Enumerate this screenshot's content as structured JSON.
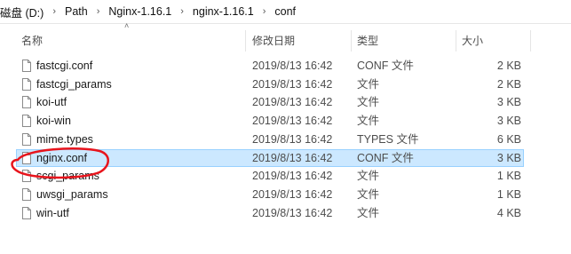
{
  "breadcrumb": [
    "磁盘 (D:)",
    "Path",
    "Nginx-1.16.1",
    "nginx-1.16.1",
    "conf"
  ],
  "columns": {
    "name": "名称",
    "date": "修改日期",
    "type": "类型",
    "size": "大小"
  },
  "files": [
    {
      "name": "fastcgi.conf",
      "date": "2019/8/13 16:42",
      "type": "CONF 文件",
      "size": "2 KB"
    },
    {
      "name": "fastcgi_params",
      "date": "2019/8/13 16:42",
      "type": "文件",
      "size": "2 KB"
    },
    {
      "name": "koi-utf",
      "date": "2019/8/13 16:42",
      "type": "文件",
      "size": "3 KB"
    },
    {
      "name": "koi-win",
      "date": "2019/8/13 16:42",
      "type": "文件",
      "size": "3 KB"
    },
    {
      "name": "mime.types",
      "date": "2019/8/13 16:42",
      "type": "TYPES 文件",
      "size": "6 KB"
    },
    {
      "name": "nginx.conf",
      "date": "2019/8/13 16:42",
      "type": "CONF 文件",
      "size": "3 KB",
      "selected": true
    },
    {
      "name": "scgi_params",
      "date": "2019/8/13 16:42",
      "type": "文件",
      "size": "1 KB"
    },
    {
      "name": "uwsgi_params",
      "date": "2019/8/13 16:42",
      "type": "文件",
      "size": "1 KB"
    },
    {
      "name": "win-utf",
      "date": "2019/8/13 16:42",
      "type": "文件",
      "size": "4 KB"
    }
  ],
  "colors": {
    "selected_bg": "#cce8ff",
    "selected_border": "#99d1ff",
    "annotation": "#e8141c"
  }
}
